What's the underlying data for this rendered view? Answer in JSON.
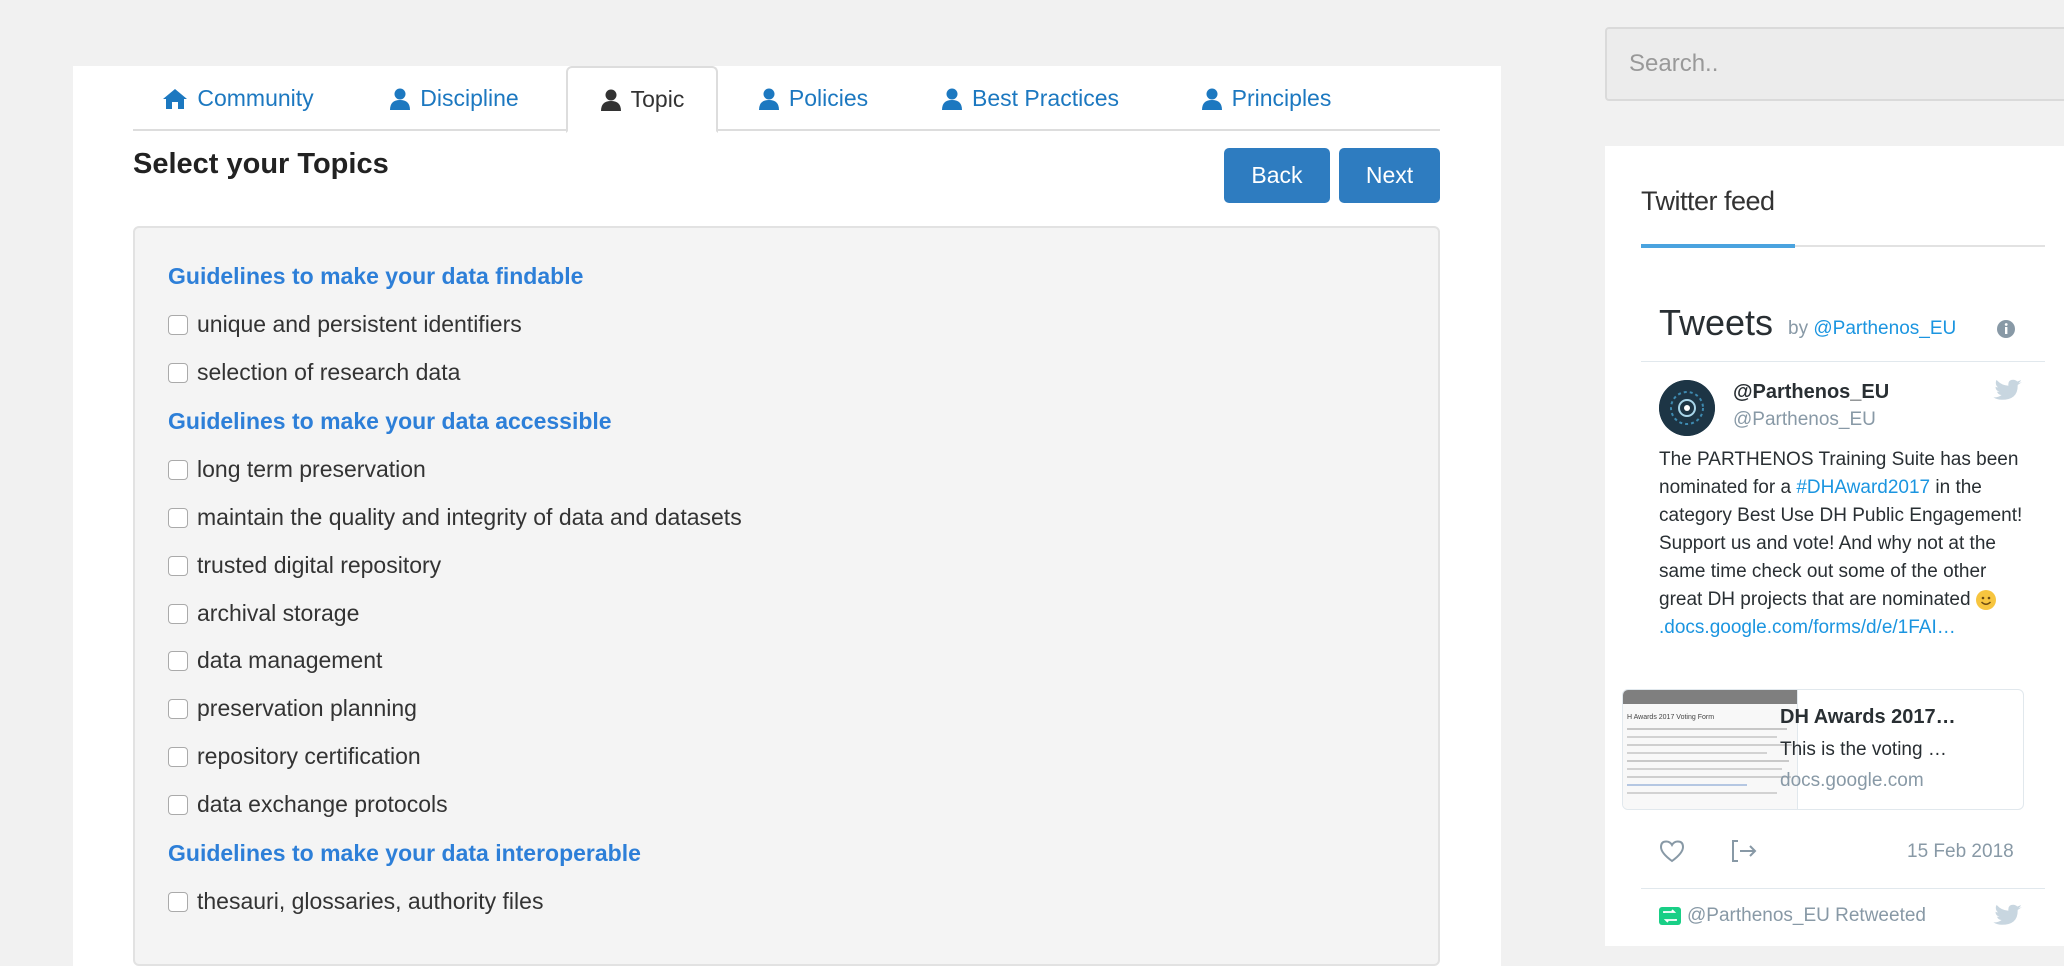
{
  "tabs": [
    {
      "label": "Community",
      "icon": "home-icon"
    },
    {
      "label": "Discipline",
      "icon": "user-icon"
    },
    {
      "label": "Topic",
      "icon": "user-icon",
      "active": true
    },
    {
      "label": "Policies",
      "icon": "user-icon"
    },
    {
      "label": "Best Practices",
      "icon": "user-icon"
    },
    {
      "label": "Principles",
      "icon": "user-icon"
    }
  ],
  "page_title": "Select your Topics",
  "buttons": {
    "back": "Back",
    "next": "Next"
  },
  "sections": [
    {
      "title": "Guidelines to make your data findable",
      "items": [
        "unique and persistent identifiers",
        "selection of research data"
      ]
    },
    {
      "title": "Guidelines to make your data accessible",
      "items": [
        "long term preservation",
        "maintain the quality and integrity of data and datasets",
        "trusted digital repository",
        "archival storage",
        "data management",
        "preservation planning",
        "repository certification",
        "data exchange protocols"
      ]
    },
    {
      "title": "Guidelines to make your data interoperable",
      "items": [
        "thesauri, glossaries, authority files"
      ]
    }
  ],
  "search": {
    "placeholder": "Search.."
  },
  "twitter": {
    "heading": "Twitter feed",
    "tweets_title": "Tweets",
    "by_prefix": "by",
    "by_handle": "@Parthenos_EU",
    "tweet": {
      "name": "@Parthenos_EU",
      "handle": "@Parthenos_EU",
      "text_before": "The PARTHENOS Training Suite has been nominated for a ",
      "hashtag": "#DHAward2017",
      "text_after": " in the category Best Use DH Public Engagement! Support us and vote! And why not at the same time check out some of the other great DH projects that are nominated ",
      "link": ".docs.google.com/forms/d/e/1FAI…",
      "card": {
        "thumb_caption": "H Awards 2017 Voting Form",
        "title": "DH Awards 2017…",
        "description": "This is the voting …",
        "host": "docs.google.com"
      },
      "date": "15 Feb 2018"
    },
    "retweeted": "@Parthenos_EU Retweeted"
  }
}
